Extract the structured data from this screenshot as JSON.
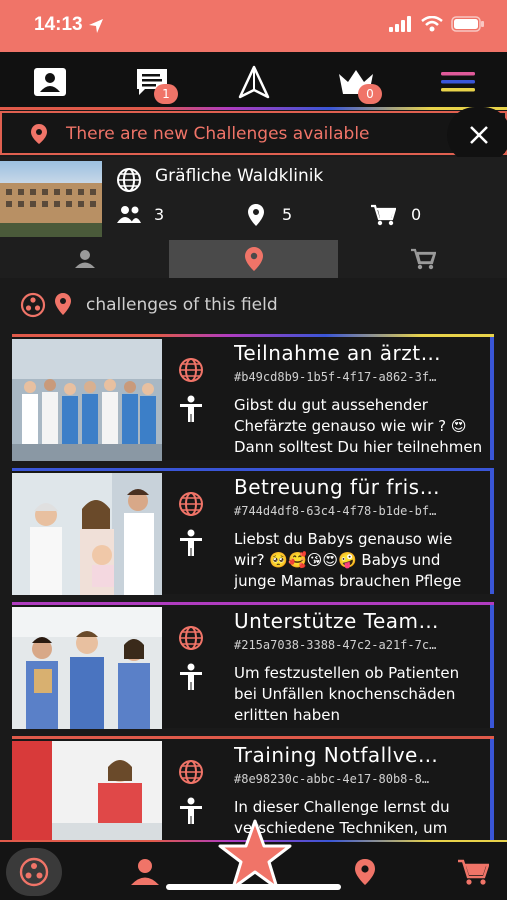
{
  "status_bar": {
    "time": "14:13"
  },
  "top_nav": {
    "messages_badge": "1",
    "crown_badge": "0",
    "colors": {
      "menu_lines": [
        "#e05a9a",
        "#3a56d8",
        "#e8d34a"
      ]
    }
  },
  "banner": {
    "text": "There are new Challenges available"
  },
  "place": {
    "name": "Gräfliche Waldklinik",
    "members": "3",
    "locations": "5",
    "cart": "0"
  },
  "tabs": [
    "person-tab",
    "location-tab",
    "cart-tab"
  ],
  "section": {
    "label": "challenges of this field"
  },
  "challenges": [
    {
      "title": "Teilnahme an ärzt…",
      "id": "#b49cd8b9-1b5f-4f17-a862-3f…",
      "description": "Gibst du gut aussehender Chefärzte genauso wie wir ? 😍 Dann solltest Du hier teilnehmen"
    },
    {
      "title": "Betreuung für fris…",
      "id": "#744d4df8-63c4-4f78-b1de-bf…",
      "description": "Liebst du Babys genauso wie wir? 🥺🥰😘😍🤪 Babys und junge Mamas brauchen Pflege"
    },
    {
      "title": "Unterstütze Team…",
      "id": "#215a7038-3388-47c2-a21f-7c…",
      "description": "Um festzustellen ob Patienten bei Unfällen knochenschäden erlitten haben"
    },
    {
      "title": "Training Notfallve…",
      "id": "#8e98230c-abbc-4e17-80b8-8…",
      "description": "In dieser Challenge lernst du verschiedene Techniken, um Leben zu retten"
    }
  ],
  "colors": {
    "accent": "#f07468",
    "bg": "#1a1a1a",
    "blue": "#3a56d8",
    "yellow": "#e8d34a",
    "purple": "#b03cc0"
  }
}
